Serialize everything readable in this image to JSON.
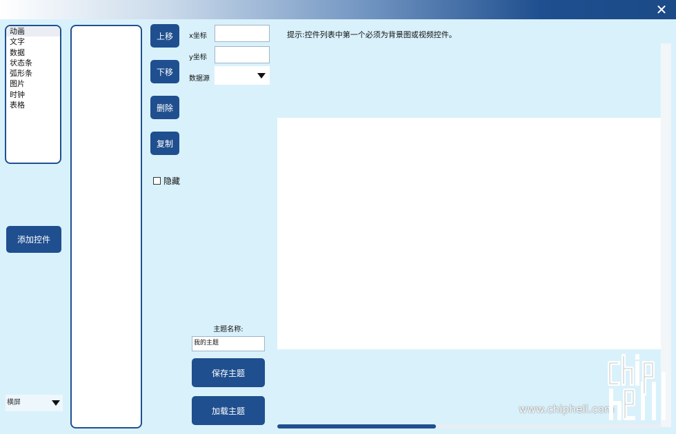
{
  "window": {
    "close_icon": "close-icon"
  },
  "control_types": [
    "动画",
    "文字",
    "数据",
    "状态条",
    "弧形条",
    "图片",
    "时钟",
    "表格"
  ],
  "buttons": {
    "add": "添加控件",
    "up": "上移",
    "down": "下移",
    "delete": "删除",
    "copy": "复制",
    "save_theme": "保存主题",
    "load_theme": "加载主题"
  },
  "orientation": {
    "value": "横屏"
  },
  "hide_checkbox": {
    "label": "隐藏",
    "checked": false
  },
  "fields": {
    "x_label": "x坐标",
    "y_label": "y坐标",
    "x_value": "",
    "y_value": "",
    "datasource_label": "数据源",
    "datasource_value": ""
  },
  "theme": {
    "label": "主题名称:",
    "value": "我的主题"
  },
  "hint": "提示:控件列表中第一个必须为背景图或视频控件。",
  "horizontal_scroll": {
    "position": 0.0,
    "visible_fraction": 0.41
  },
  "watermark": {
    "url": "www.chiphell.com",
    "logo": "chiphell-logo"
  },
  "colors": {
    "accent": "#1f4f8f",
    "background": "#d9f1fb",
    "preview": "#ffffff"
  }
}
